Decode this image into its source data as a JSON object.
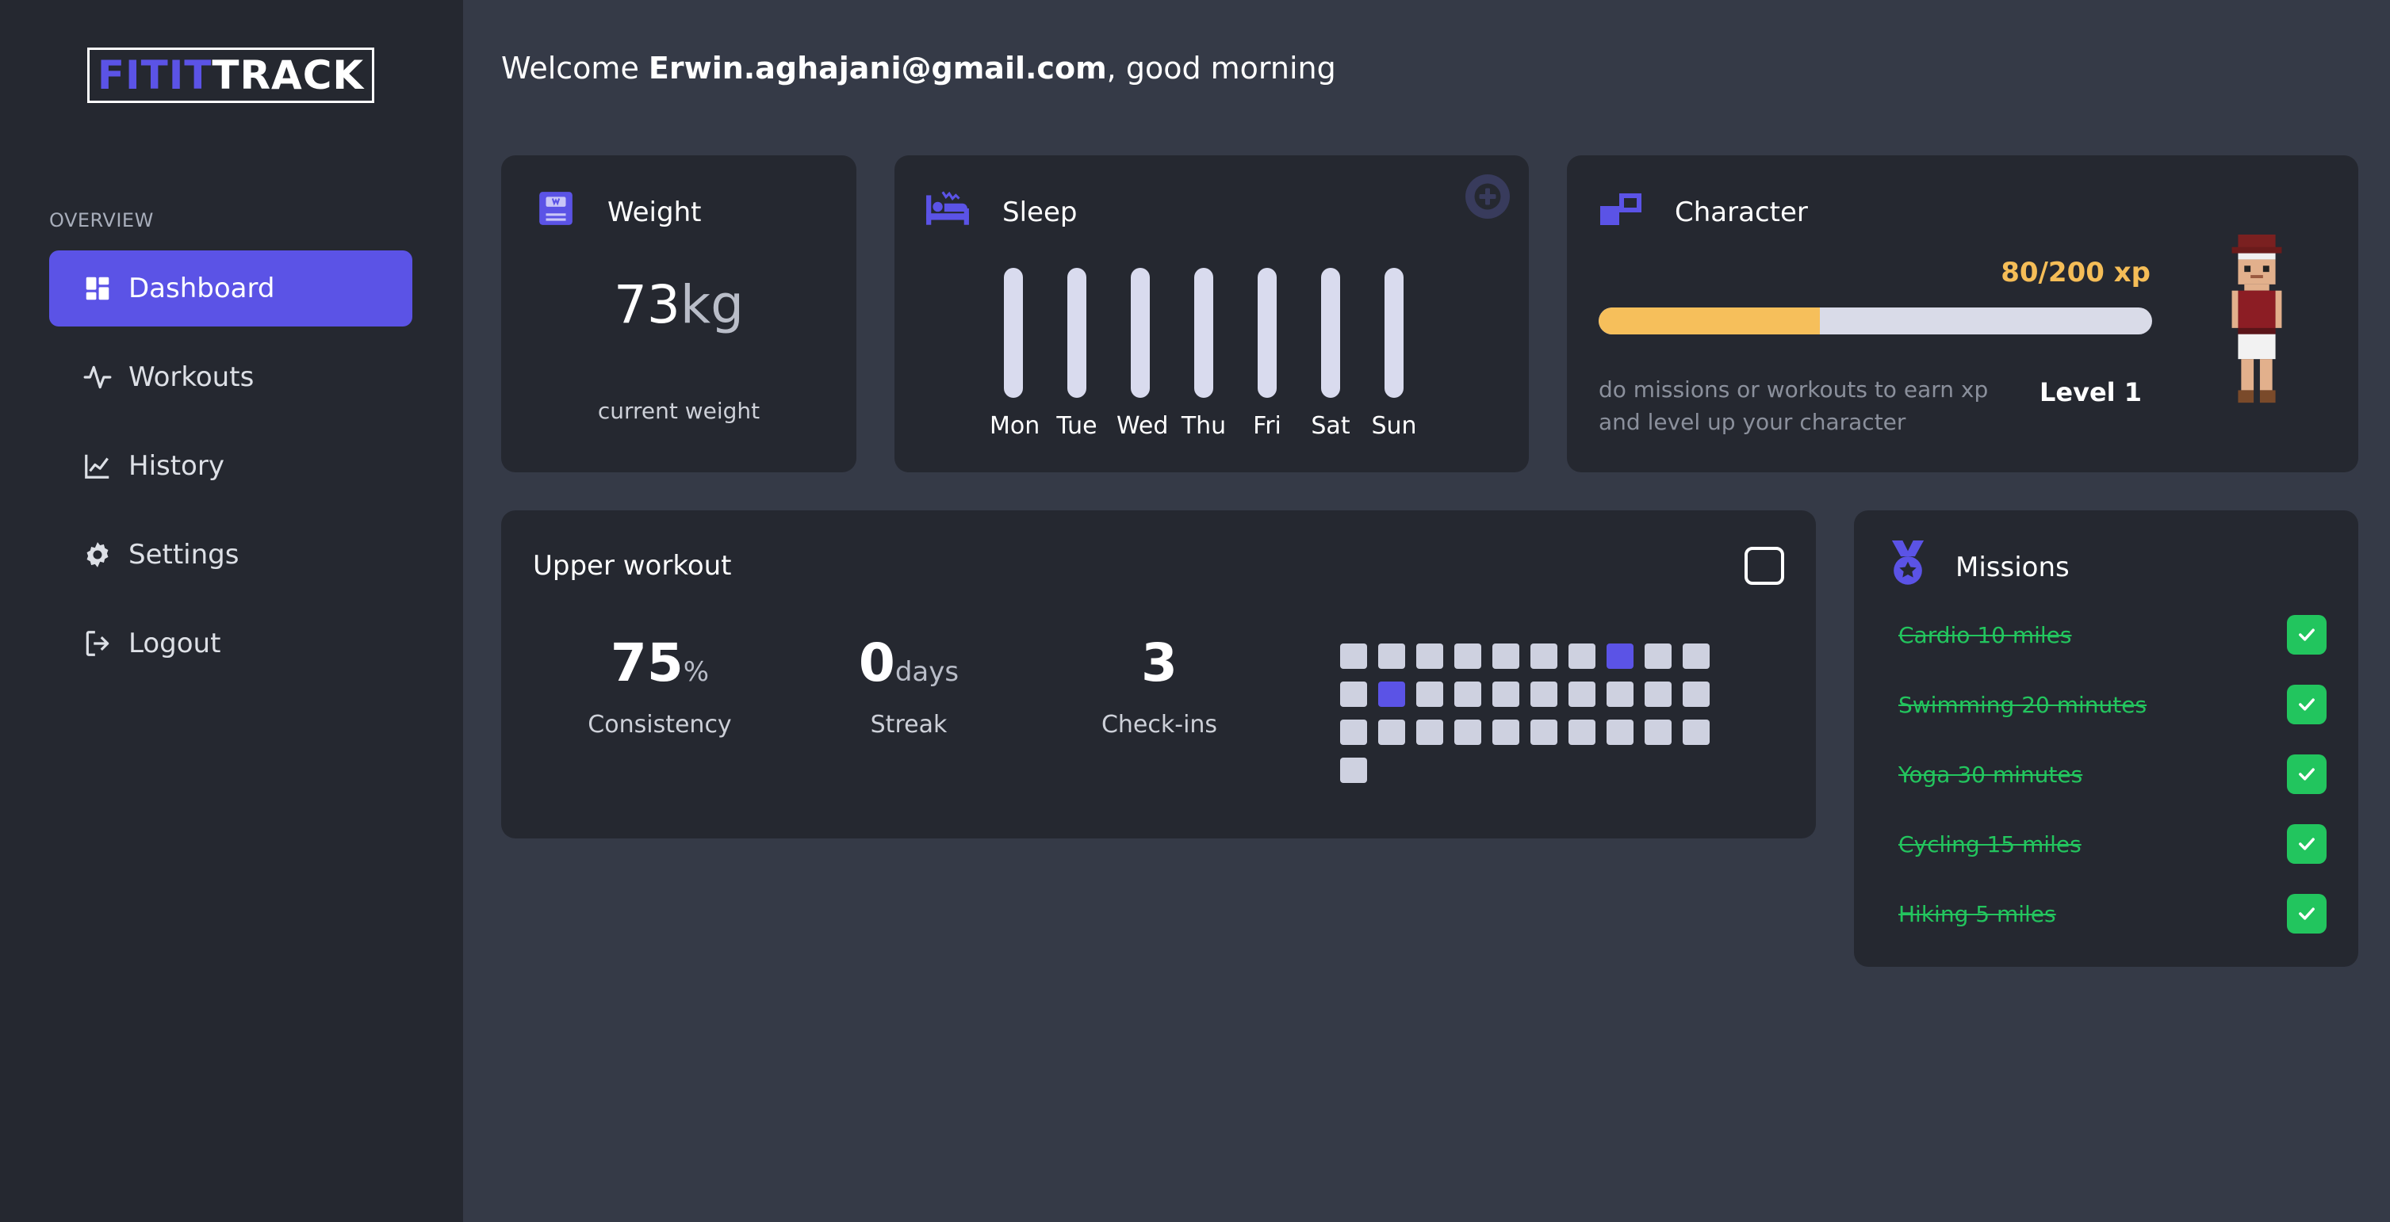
{
  "brand": {
    "fit": "FITIT",
    "track": "TRACK"
  },
  "sidebar": {
    "heading": "OVERVIEW",
    "items": [
      {
        "label": "Dashboard",
        "icon": "dashboard-icon",
        "active": true
      },
      {
        "label": "Workouts",
        "icon": "activity-icon",
        "active": false
      },
      {
        "label": "History",
        "icon": "chart-line-icon",
        "active": false
      },
      {
        "label": "Settings",
        "icon": "gear-icon",
        "active": false
      },
      {
        "label": "Logout",
        "icon": "logout-icon",
        "active": false
      }
    ]
  },
  "header": {
    "welcome_prefix": "Welcome ",
    "user_email": "Erwin.aghajani@gmail.com",
    "welcome_suffix": ", good morning"
  },
  "weight": {
    "title": "Weight",
    "value": "73",
    "unit": "kg",
    "label": "current weight"
  },
  "sleep": {
    "title": "Sleep",
    "days": [
      "Mon",
      "Tue",
      "Wed",
      "Thu",
      "Fri",
      "Sat",
      "Sun"
    ]
  },
  "character": {
    "title": "Character",
    "xp_text": "80/200 xp",
    "xp_current": 80,
    "xp_max": 200,
    "description": "do missions or workouts to earn xp and level up your character",
    "level": "Level 1"
  },
  "workout": {
    "title": "Upper workout",
    "consistency_value": "75",
    "consistency_suffix": "%",
    "consistency_label": "Consistency",
    "streak_value": "0",
    "streak_suffix": "days",
    "streak_label": "Streak",
    "checkins_value": "3",
    "checkins_label": "Check-ins",
    "calendar": {
      "total_cells": 31,
      "active_cells": [
        7,
        11
      ]
    }
  },
  "missions": {
    "title": "Missions",
    "items": [
      {
        "label": "Cardio 10 miles",
        "done": true
      },
      {
        "label": "Swimming 20 minutes",
        "done": true
      },
      {
        "label": "Yoga 30 minutes",
        "done": true
      },
      {
        "label": "Cycling 15 miles",
        "done": true
      },
      {
        "label": "Hiking 5 miles",
        "done": true
      }
    ]
  },
  "colors": {
    "accent": "#5b53e6",
    "xp": "#f6bf5b",
    "success": "#22c55e",
    "card": "#252830",
    "background": "#353a47"
  }
}
